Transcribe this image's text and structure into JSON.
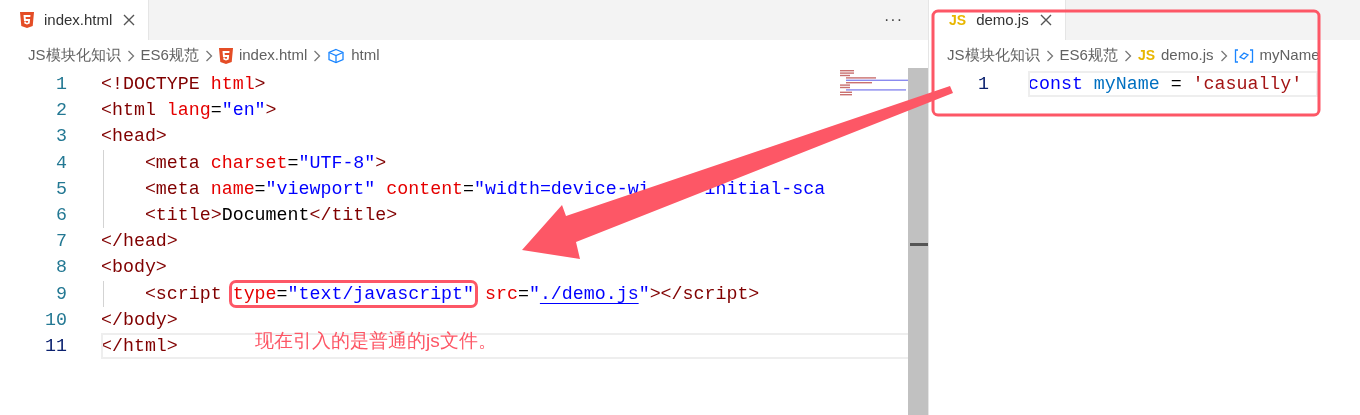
{
  "left_editor": {
    "tabs": [
      {
        "label": "index.html",
        "kind": "html",
        "selected": true
      }
    ],
    "more": "···",
    "breadcrumb": [
      {
        "label": "JS模块化知识",
        "kind": "folder"
      },
      {
        "label": "ES6规范",
        "kind": "folder"
      },
      {
        "label": "index.html",
        "kind": "html"
      },
      {
        "label": "html",
        "kind": "element"
      }
    ],
    "lines": [
      {
        "number": "1",
        "current": false,
        "tokens": [
          {
            "kind": "tag",
            "text": "<!DOCTYPE"
          },
          {
            "kind": "attr",
            "text": " html"
          },
          {
            "kind": "tag",
            "text": ">"
          }
        ]
      },
      {
        "number": "2",
        "current": false,
        "tokens": [
          {
            "kind": "tag",
            "text": "<html"
          },
          {
            "kind": "attr",
            "text": " lang"
          },
          {
            "kind": "plain",
            "text": "="
          },
          {
            "kind": "value",
            "text": "\"en\""
          },
          {
            "kind": "tag",
            "text": ">"
          }
        ]
      },
      {
        "number": "3",
        "current": false,
        "tokens": [
          {
            "kind": "tag",
            "text": "<head>"
          }
        ]
      },
      {
        "number": "4",
        "current": false,
        "tokens": [
          {
            "kind": "tag",
            "text": "    <meta"
          },
          {
            "kind": "attr",
            "text": " charset"
          },
          {
            "kind": "plain",
            "text": "="
          },
          {
            "kind": "value",
            "text": "\"UTF-8\""
          },
          {
            "kind": "tag",
            "text": ">"
          }
        ]
      },
      {
        "number": "5",
        "current": false,
        "tokens": [
          {
            "kind": "tag",
            "text": "    <meta"
          },
          {
            "kind": "attr",
            "text": " name"
          },
          {
            "kind": "plain",
            "text": "="
          },
          {
            "kind": "value",
            "text": "\"viewport\""
          },
          {
            "kind": "attr",
            "text": " content"
          },
          {
            "kind": "plain",
            "text": "="
          },
          {
            "kind": "value",
            "text": "\"width=device-wi"
          },
          {
            "kind": "covered"
          },
          {
            "kind": "value",
            "text": "initial-sca"
          }
        ]
      },
      {
        "number": "6",
        "current": false,
        "tokens": [
          {
            "kind": "tag",
            "text": "    <title>"
          },
          {
            "kind": "plain",
            "text": "Document"
          },
          {
            "kind": "tag",
            "text": "</title>"
          }
        ]
      },
      {
        "number": "7",
        "current": false,
        "tokens": [
          {
            "kind": "tag",
            "text": "</head>"
          }
        ]
      },
      {
        "number": "8",
        "current": false,
        "tokens": [
          {
            "kind": "tag",
            "text": "<body>"
          }
        ]
      },
      {
        "number": "9",
        "current": false,
        "tokens": [
          {
            "kind": "tag",
            "text": "    <script "
          },
          {
            "kind": "attr",
            "text": "type",
            "boxed": true
          },
          {
            "kind": "plain",
            "text": "=",
            "boxed": true
          },
          {
            "kind": "value",
            "text": "\"text/javascript\"",
            "boxed": true
          },
          {
            "kind": "attr",
            "text": " src"
          },
          {
            "kind": "plain",
            "text": "="
          },
          {
            "kind": "value",
            "text": "\""
          },
          {
            "kind": "link",
            "text": "./demo.js"
          },
          {
            "kind": "value",
            "text": "\""
          },
          {
            "kind": "tag",
            "text": "></script>"
          }
        ]
      },
      {
        "number": "10",
        "current": false,
        "tokens": [
          {
            "kind": "tag",
            "text": "</body>"
          }
        ]
      },
      {
        "number": "11",
        "current": true,
        "tokens": [
          {
            "kind": "tag",
            "text": "</html>"
          }
        ]
      }
    ]
  },
  "right_editor": {
    "tabs": [
      {
        "label": "demo.js",
        "kind": "js",
        "icon_label": "JS",
        "selected": true
      }
    ],
    "breadcrumb": [
      {
        "label": "JS模块化知识",
        "kind": "folder"
      },
      {
        "label": "ES6规范",
        "kind": "folder"
      },
      {
        "label": "demo.js",
        "kind": "js",
        "icon_label": "JS"
      },
      {
        "label": "myName",
        "kind": "variable"
      }
    ],
    "lines": [
      {
        "number": "1",
        "current": true,
        "tokens": [
          {
            "kind": "keyword",
            "text": "const"
          },
          {
            "kind": "variable",
            "text": " myName"
          },
          {
            "kind": "plain",
            "text": " = "
          },
          {
            "kind": "string",
            "text": "'casually'"
          }
        ]
      }
    ]
  },
  "annotation": {
    "note": "现在引入的是普通的js文件。"
  }
}
